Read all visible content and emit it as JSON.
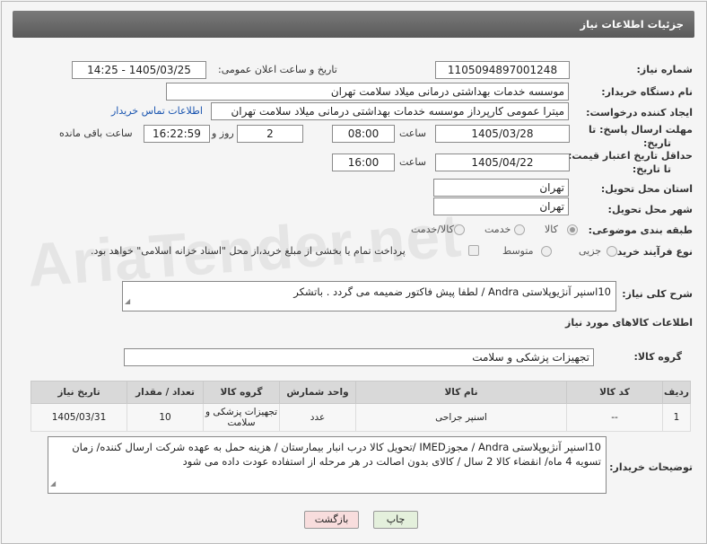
{
  "header": {
    "title": "جزئیات اطلاعات نیاز"
  },
  "fields": {
    "need_number_label": "شماره نیاز:",
    "need_number": "1105094897001248",
    "announce_label": "تاریخ و ساعت اعلان عمومی:",
    "announce_value": "1405/03/25 - 14:25",
    "buyer_org_label": "نام دستگاه خریدار:",
    "buyer_org": "موسسه خدمات بهداشتی درمانی میلاد سلامت تهران",
    "requester_label": "ایجاد کننده درخواست:",
    "requester": "میترا عمومی کارپرداز موسسه خدمات بهداشتی درمانی میلاد سلامت تهران",
    "contact_link": "اطلاعات تماس خریدار",
    "deadline_label_1": "مهلت ارسال پاسخ: تا",
    "deadline_label_2": "تاریخ:",
    "deadline_date": "1405/03/28",
    "time_label": "ساعت",
    "deadline_time": "08:00",
    "days": "2",
    "days_label": "روز و",
    "remaining": "16:22:59",
    "remaining_label": "ساعت باقی مانده",
    "validity_label_1": "حداقل تاریخ اعتبار قیمت:",
    "validity_label_2": "تا تاریخ:",
    "validity_date": "1405/04/22",
    "validity_time": "16:00",
    "province_label": "استان محل تحویل:",
    "province": "تهران",
    "city_label": "شهر محل تحویل:",
    "city": "تهران",
    "category_label": "طبقه بندی موضوعی:",
    "category_options": [
      "کالا",
      "خدمت",
      "کالا/خدمت"
    ],
    "process_label": "نوع فرآیند خرید :",
    "process_options": [
      "جزیی",
      "متوسط"
    ],
    "payment_note": "پرداخت تمام یا بخشی از مبلغ خرید،از محل \"اسناد خزانه اسلامی\" خواهد بود.",
    "summary_label": "شرح کلی نیاز:",
    "summary": "10اسنپر آنژیوپلاستی Andra /  لطفا پیش فاکتور ضمیمه می گردد . باتشکر",
    "goods_info_label": "اطلاعات کالاهای مورد نیاز",
    "goods_group_label": "گروه کالا:",
    "goods_group": "تجهیزات پزشکی و سلامت",
    "buyer_notes_label": "توضیحات خریدار:",
    "buyer_notes": "10اسنپر آنژیوپلاستی Andra / مجوزIMED /تحویل کالا درب انبار بیمارستان / هزینه حمل به عهده شرکت ارسال کننده/ زمان تسویه 4 ماه/ انقضاء کالا 2 سال / کالای بدون اصالت در هر مرحله از استفاده عودت داده می شود"
  },
  "table": {
    "headers": [
      "ردیف",
      "کد کالا",
      "نام کالا",
      "واحد شمارش",
      "گروه کالا",
      "تعداد / مقدار",
      "تاریخ نیاز"
    ],
    "rows": [
      [
        "1",
        "--",
        "اسنپر جراحی",
        "عدد",
        "تجهیزات پزشکی و سلامت",
        "10",
        "1405/03/31"
      ]
    ]
  },
  "buttons": {
    "print": "چاپ",
    "back": "بازگشت"
  },
  "watermark": "AriaTender.net",
  "colors": {
    "header_bg": "#666666",
    "link": "#1a55b0",
    "back_btn": "#f7d6d6",
    "print_btn": "#d9ead3"
  }
}
